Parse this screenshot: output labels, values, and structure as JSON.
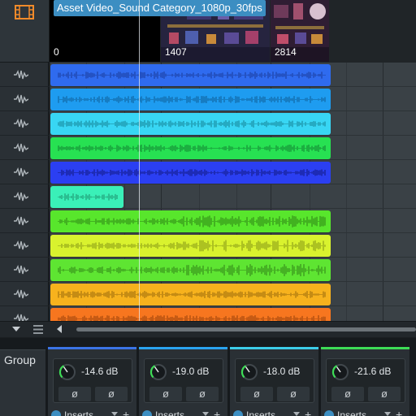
{
  "video_track": {
    "title": "Asset Video_Sound Category_1080p_30fps",
    "frame_markers": [
      "0",
      "1407",
      "2814"
    ]
  },
  "audio_tracks": [
    {
      "color": "#2f6bef",
      "waveform": "#1f48b0",
      "start": 0,
      "end": 1.0
    },
    {
      "color": "#1e9cf0",
      "waveform": "#126fae",
      "start": 0,
      "end": 1.0
    },
    {
      "color": "#38d6f4",
      "waveform": "#1e97ad",
      "start": 0,
      "end": 1.0
    },
    {
      "color": "#27e152",
      "waveform": "#17993a",
      "start": 0,
      "end": 1.0
    },
    {
      "color": "#2b3ff2",
      "waveform": "#18239c",
      "start": 0,
      "end": 1.0
    },
    {
      "color": "#3af0b8",
      "waveform": "#25a880",
      "start": 0,
      "end": 0.26
    },
    {
      "color": "#58e62c",
      "waveform": "#389b1c",
      "start": 0,
      "end": 1.0
    },
    {
      "color": "#d9f22e",
      "waveform": "#9aae1c",
      "start": 0,
      "end": 1.0
    },
    {
      "color": "#5ee532",
      "waveform": "#3c9c1f",
      "start": 0,
      "end": 1.0
    },
    {
      "color": "#f7b21d",
      "waveform": "#b07b10",
      "start": 0,
      "end": 1.0
    },
    {
      "color": "#f7761f",
      "waveform": "#b04f10",
      "start": 0,
      "end": 1.0
    }
  ],
  "toolbar": {
    "scroll_down_icon": "chevron-down-icon",
    "list_icon": "list-icon"
  },
  "mixer": {
    "group_label": "Group",
    "channels": [
      {
        "volume": "-14.6 dB",
        "color": "#3b74e6",
        "phase_a": "ø",
        "phase_b": "ø",
        "inserts_label": "Inserts"
      },
      {
        "volume": "-19.0 dB",
        "color": "#2aa3ef",
        "phase_a": "ø",
        "phase_b": "ø",
        "inserts_label": "Inserts"
      },
      {
        "volume": "-18.0 dB",
        "color": "#3ccde8",
        "phase_a": "ø",
        "phase_b": "ø",
        "inserts_label": "Inserts"
      },
      {
        "volume": "-21.6 dB",
        "color": "#3ddc56",
        "phase_a": "ø",
        "phase_b": "ø",
        "inserts_label": "Inserts"
      }
    ]
  }
}
